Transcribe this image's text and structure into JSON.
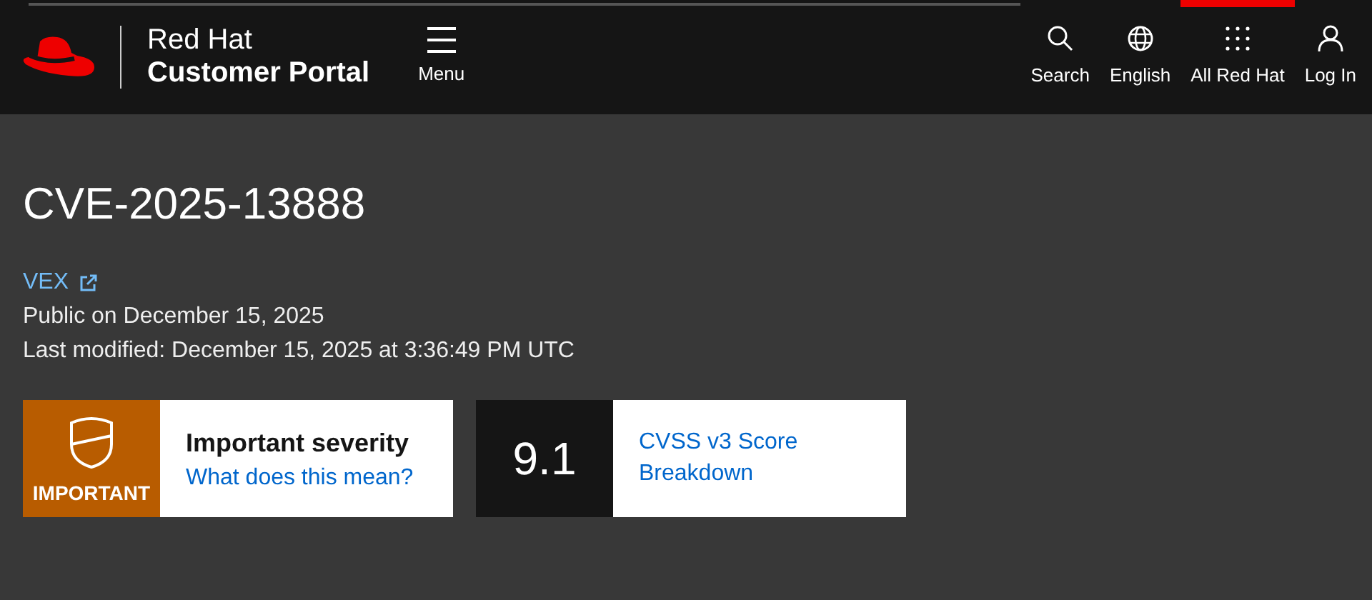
{
  "header": {
    "brand_line_1": "Red Hat",
    "brand_line_2": "Customer Portal",
    "menu_label": "Menu",
    "nav": [
      {
        "kind": "search",
        "label": "Search",
        "selected": false
      },
      {
        "kind": "globe",
        "label": "English",
        "selected": false
      },
      {
        "kind": "grid",
        "label": "All Red Hat",
        "selected": true
      },
      {
        "kind": "user",
        "label": "Log In",
        "selected": false
      }
    ]
  },
  "page": {
    "title": "CVE-2025-13888",
    "vex_link": "VEX",
    "public_on": "Public on December 15, 2025",
    "last_modified": "Last modified: December 15, 2025 at 3:36:49 PM UTC"
  },
  "severity": {
    "badge": "IMPORTANT",
    "color": "#b85c00",
    "heading": "Important severity",
    "link": "What does this mean?"
  },
  "score": {
    "value": "9.1",
    "link": "CVSS v3 Score Breakdown"
  }
}
